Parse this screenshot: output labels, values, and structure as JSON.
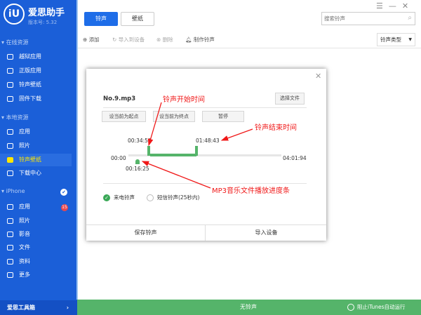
{
  "app": {
    "logo": "iU",
    "title": "爱思助手",
    "version": "版本号: 5.32"
  },
  "sidebar": {
    "sections": [
      {
        "label": "在线资源",
        "items": [
          {
            "label": "越狱应用",
            "icon": "jailbreak-icon"
          },
          {
            "label": "正版应用",
            "icon": "appstore-icon"
          },
          {
            "label": "铃声壁纸",
            "icon": "ringtone-icon"
          },
          {
            "label": "固件下载",
            "icon": "firmware-icon"
          }
        ]
      },
      {
        "label": "本地资源",
        "items": [
          {
            "label": "应用",
            "icon": "apps-icon"
          },
          {
            "label": "照片",
            "icon": "photo-icon"
          },
          {
            "label": "铃声壁纸",
            "icon": "ringtone-icon",
            "selected": true
          },
          {
            "label": "下载中心",
            "icon": "download-icon"
          }
        ]
      },
      {
        "label": "iPhone",
        "items": [
          {
            "label": "应用",
            "icon": "apps-icon",
            "badge": "15"
          },
          {
            "label": "照片",
            "icon": "photo-icon"
          },
          {
            "label": "影音",
            "icon": "media-icon"
          },
          {
            "label": "文件",
            "icon": "file-icon"
          },
          {
            "label": "资料",
            "icon": "list-icon"
          },
          {
            "label": "更多",
            "icon": "more-icon"
          }
        ]
      }
    ],
    "iphone_check": "✔",
    "toolbox": "爱思工具箱"
  },
  "tabs": [
    "铃声",
    "壁纸"
  ],
  "search": {
    "placeholder": "搜索铃声"
  },
  "toolbar": {
    "add": "添加",
    "import": "导入到设备",
    "delete": "删除",
    "make": "制作铃声",
    "type_select": "铃声类型"
  },
  "dialog": {
    "filename": "No.9.mp3",
    "choose_file": "选择文件",
    "set_start": "设当前为起点",
    "set_end": "设当前为终点",
    "pause": "暂停",
    "start_time": "00:34:56",
    "end_time": "01:48:43",
    "zero": "00:00",
    "total": "04:01:94",
    "current": "00:16:25",
    "radio_call": "来电铃声",
    "radio_sms": "短信铃声(25秒内)",
    "save": "保存铃声",
    "import": "导入设备"
  },
  "annotations": {
    "start": "铃声开始时间",
    "end": "铃声结束时间",
    "progress": "MP3音乐文件播放进度条"
  },
  "status": {
    "text": "无铃声",
    "itunes": "阻止iTunes自动运行"
  },
  "colors": {
    "sidebar": "#1b5fd8",
    "accent": "#1e6de8",
    "green": "#55b46a",
    "annotation": "#f01818"
  }
}
